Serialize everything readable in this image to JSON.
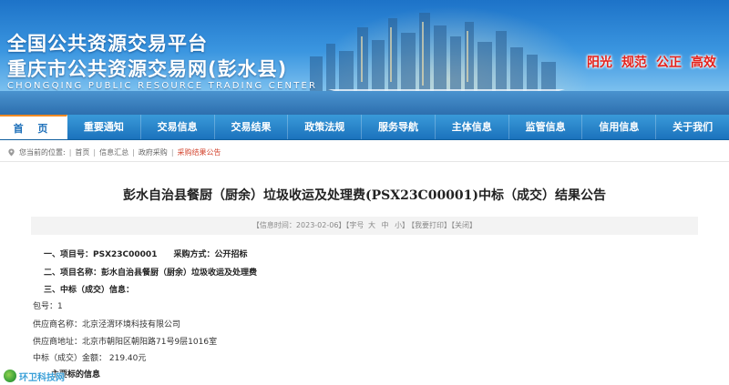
{
  "header": {
    "title_line1": "全国公共资源交易平台",
    "title_line2": "重庆市公共资源交易网(彭水县)",
    "subtitle": "CHONGQING PUBLIC RESOURCE TRADING CENTER",
    "slogans": [
      "阳光",
      "规范",
      "公正",
      "高效"
    ],
    "slogan_color": "#e3211b"
  },
  "nav": {
    "items": [
      "首 页",
      "重要通知",
      "交易信息",
      "交易结果",
      "政策法规",
      "服务导航",
      "主体信息",
      "监管信息",
      "信用信息",
      "关于我们"
    ],
    "active_index": 0,
    "accent_color": "#1b72bc"
  },
  "breadcrumb": {
    "prefix": "您当前的位置:",
    "items": [
      "首页",
      "信息汇总",
      "政府采购"
    ],
    "current": "采购结果公告"
  },
  "notice": {
    "title": "彭水自治县餐厨（厨余）垃圾收运及处理费(PSX23C00001)中标（成交）结果公告",
    "info": {
      "date": "【信息时间：2023-02-06】",
      "font_label": "【字号",
      "font_large": "大",
      "font_medium": "中",
      "font_small": "小】",
      "print": "【我要打印】",
      "close": "【关闭】"
    },
    "lines": {
      "project_no": "一、项目号：PSX23C00001",
      "method": "采购方式：公开招标",
      "project_name": "二、项目名称：彭水自治县餐厨（厨余）垃圾收运及处理费",
      "result_heading": "三、中标（成交）信息：",
      "package": "包号：1",
      "supplier_name": "供应商名称：北京泾渭环境科技有限公司",
      "supplier_addr": "供应商地址：北京市朝阳区朝阳路71号9层1016室",
      "amount": "中标（成交）金额：  219.40元",
      "subject_heading": "主要标的信息"
    }
  },
  "watermark": {
    "text": "环卫科技网"
  }
}
